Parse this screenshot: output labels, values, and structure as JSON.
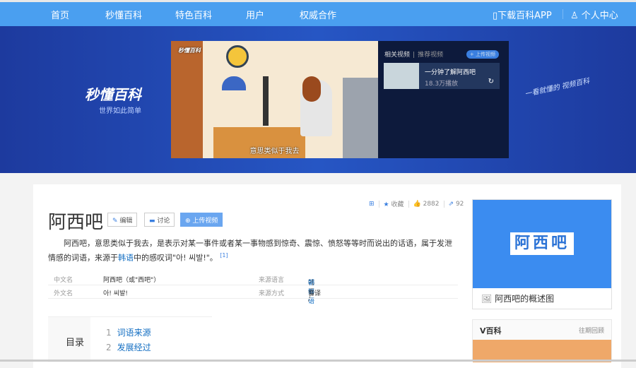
{
  "nav": {
    "items": [
      "首页",
      "秒懂百科",
      "特色百科",
      "用户",
      "权威合作"
    ],
    "app": "下载百科APP",
    "user": "个人中心"
  },
  "banner": {
    "logo": "秒懂百科",
    "slogan": "世界如此简单",
    "handwriting": "一看就懂的 视频百科",
    "video_tag": "秒懂百科",
    "caption": "意思类似于我去",
    "playlist": {
      "tab_related": "相关视频",
      "tab_recommend": "推荐视频",
      "upload": "+ 上传视频",
      "item_title": "一分钟了解阿西吧",
      "item_plays": "18.3万播放"
    }
  },
  "entry": {
    "title": "阿西吧",
    "edit": "编辑",
    "discuss": "讨论",
    "upload_video": "上传视频",
    "favorite": "收藏",
    "likes": "2882",
    "shares": "92",
    "summary_pre": "阿西吧，意思类似于我去，是表示对某一事件或者某一事物感到惊奇、震惊、愤怒等等时而说出的话语，属于发泄情感的词语，来源于",
    "summary_link": "韩语",
    "summary_post": "中的感叹词\"아! 씨발!\"。",
    "ref": "[1]",
    "info": {
      "cn_name_label": "中文名",
      "cn_name": "阿西吧（或\"西吧\"）",
      "foreign_label": "外文名",
      "foreign": "아! 씨발!",
      "lang_label": "来源语言",
      "lang": "韩语 / ",
      "lang_link": "朝鲜语",
      "method_label": "来源方式",
      "method": "音译"
    },
    "toc": {
      "label": "目录",
      "items": [
        {
          "n": "1",
          "t": "词语来源"
        },
        {
          "n": "2",
          "t": "发展经过"
        }
      ]
    }
  },
  "side": {
    "image_text": "阿西吧",
    "image_caption": "阿西吧的概述图",
    "vbaike": "V百科",
    "past": "往期回顾"
  }
}
